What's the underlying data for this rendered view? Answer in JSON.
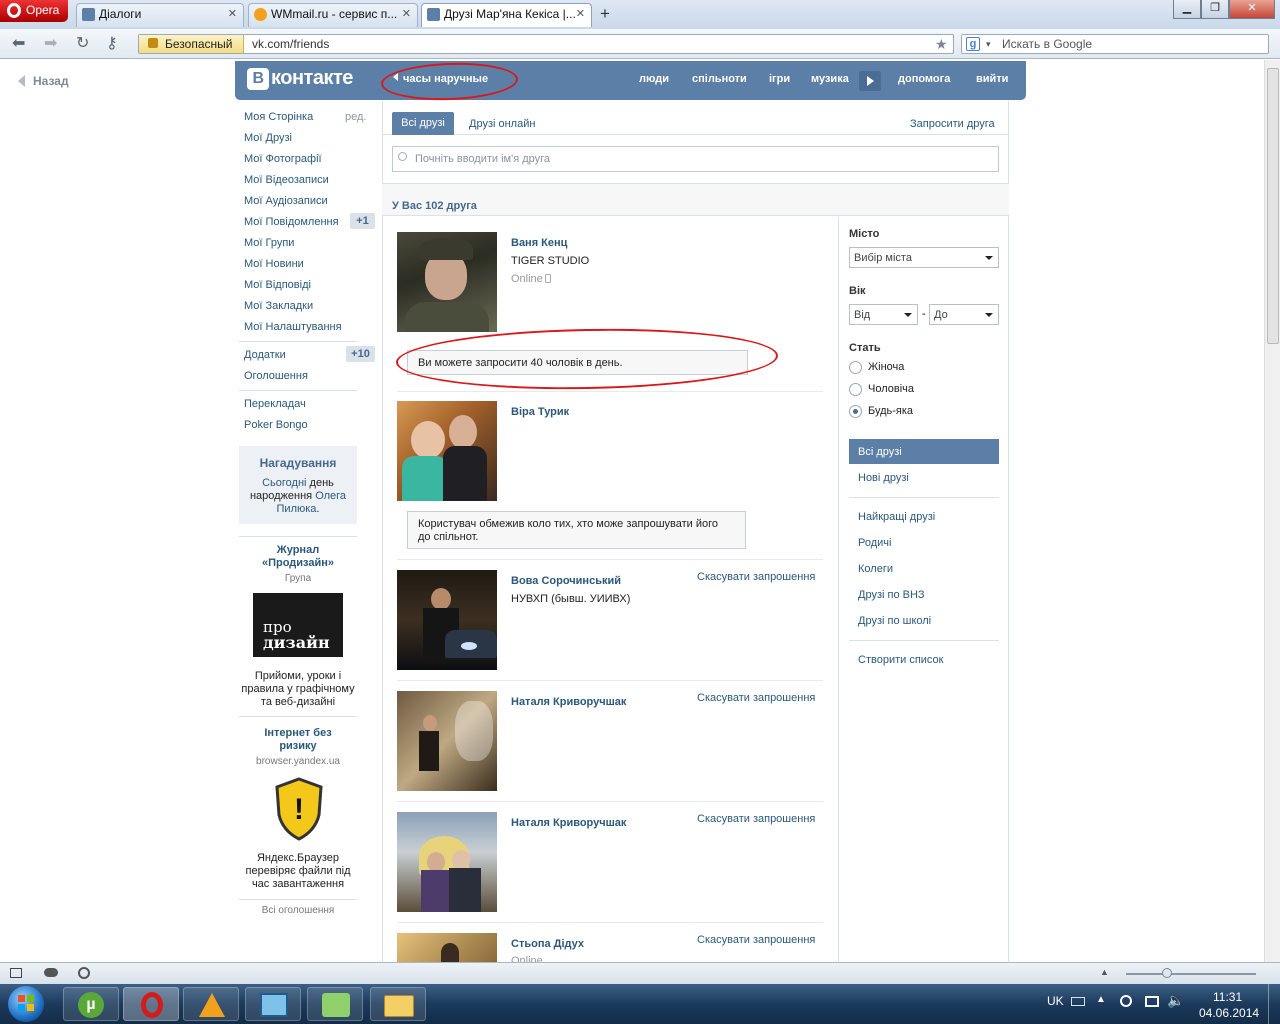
{
  "browser": {
    "menu_label": "Opera",
    "tabs": [
      {
        "title": "Діалоги"
      },
      {
        "title": "WMmail.ru - сервис п..."
      },
      {
        "title": "Друзі Мар'яна Кекіса |..."
      }
    ],
    "security_label": "Безопасный",
    "url": "vk.com/friends",
    "search_placeholder": "Искать в Google"
  },
  "vk": {
    "back_label": "Назад",
    "logo_text": "контакте",
    "logo_letter": "В",
    "status_text": "часы наручные",
    "nav": [
      "люди",
      "спільноти",
      "ігри",
      "музика",
      "допомога",
      "вийти"
    ],
    "left_menu": {
      "items": [
        {
          "label": "Моя Сторінка"
        },
        {
          "label": "Мої Друзі"
        },
        {
          "label": "Мої Фотографії"
        },
        {
          "label": "Мої Відеозаписи"
        },
        {
          "label": "Мої Аудіозаписи"
        },
        {
          "label": "Мої Повідомлення"
        },
        {
          "label": "Мої Групи"
        },
        {
          "label": "Мої Новини"
        },
        {
          "label": "Мої Відповіді"
        },
        {
          "label": "Мої Закладки"
        },
        {
          "label": "Мої Налаштування"
        },
        {
          "label": "Додатки"
        },
        {
          "label": "Оголошення"
        },
        {
          "label": "Перекладач"
        },
        {
          "label": "Poker Bongo"
        }
      ],
      "edit_label": "ред.",
      "messages_badge": "+1",
      "apps_badge": "+10"
    },
    "reminder": {
      "title": "Нагадування",
      "today": "Сьогодні",
      "day_of": "день",
      "birthday": "народження",
      "name_first": "Олега",
      "name_last": "Пилюка",
      "end": "."
    },
    "ads": [
      {
        "title_1": "Журнал",
        "title_2": "«Продизайн»",
        "subtitle": "Група",
        "image_line1": "про",
        "image_line2": "дизайн",
        "text_1": "Прийоми, уроки і",
        "text_2": "правила у графічному",
        "text_3": "та веб-дизайні"
      },
      {
        "title_1": "Інтернет без",
        "title_2": "ризику",
        "subtitle": "browser.yandex.ua",
        "text_1": "Яндекс.Браузер",
        "text_2": "перевіряє файли під",
        "text_3": "час завантаження"
      }
    ],
    "all_ads_label": "Всі оголошення",
    "tabs": {
      "all": "Всі друзі",
      "online": "Друзі онлайн",
      "invite": "Запросити друга"
    },
    "search_placeholder": "Почніть вводити ім'я друга",
    "count_label": "У Вас 102 друга",
    "friends": [
      {
        "name": "Ваня Кенц",
        "line1": "TIGER STUDIO",
        "line2": "Online",
        "cancel": ""
      },
      {
        "name": "Віра Турик",
        "line1": "",
        "line2": "",
        "cancel": ""
      },
      {
        "name": "Вова Сорочинський",
        "line1": "НУВХП (бывш. УИИВХ)",
        "line2": "",
        "cancel": "Скасувати запрошення"
      },
      {
        "name": "Наталя Криворучшак",
        "line1": "",
        "line2": "",
        "cancel": "Скасувати запрошення"
      },
      {
        "name": "Наталя Криворучшак",
        "line1": "",
        "line2": "",
        "cancel": "Скасувати запрошення"
      },
      {
        "name": "Стьопа Дідух",
        "line1": "",
        "line2": "Online",
        "cancel": "Скасувати запрошення"
      }
    ],
    "notice_invite": "Ви можете запросити 40 чоловік в день.",
    "notice_restricted_1": "Користувач обмежив коло тих, хто може запрошувати його",
    "notice_restricted_2": "до спільнот.",
    "filter": {
      "city_label": "Місто",
      "city_value": "Вибір міста",
      "age_label": "Вік",
      "age_from": "Від",
      "age_dash": "-",
      "age_to": "До",
      "sex_label": "Стать",
      "sex_options": [
        {
          "label": "Жіноча",
          "selected": false
        },
        {
          "label": "Чоловіча",
          "selected": false
        },
        {
          "label": "Будь-яка",
          "selected": true
        }
      ],
      "lists": [
        "Всі друзі",
        "Нові друзі",
        "Найкращі друзі",
        "Родичі",
        "Колеги",
        "Друзі по ВНЗ",
        "Друзі по школі",
        "Створити список"
      ]
    }
  },
  "taskbar": {
    "language": "UK",
    "time": "11:31",
    "date": "04.06.2014"
  },
  "colors": {
    "vk_blue": "#5b7fa6",
    "link": "#2b587a",
    "annotation_red": "#d9181c"
  }
}
